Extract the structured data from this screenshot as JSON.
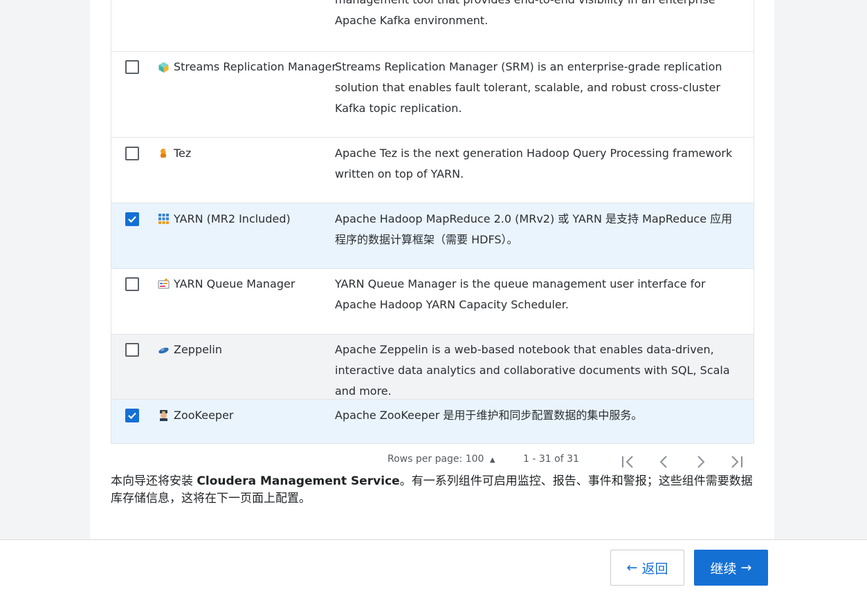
{
  "services": [
    {
      "name": "",
      "icon": "",
      "description": "management tool that provides end-to-end visibility in an enterprise Apache Kafka environment.",
      "checked": false
    },
    {
      "name": "Streams Replication Manager",
      "icon": "streams-replication-manager-icon",
      "description": "Streams Replication Manager (SRM) is an enterprise-grade replication solution that enables fault tolerant, scalable, and robust cross-cluster Kafka topic replication.",
      "checked": false
    },
    {
      "name": "Tez",
      "icon": "tez-icon",
      "description": "Apache Tez is the next generation Hadoop Query Processing framework written on top of YARN.",
      "checked": false
    },
    {
      "name": "YARN (MR2 Included)",
      "icon": "yarn-icon",
      "description": "Apache Hadoop MapReduce 2.0 (MRv2) 或 YARN 是支持 MapReduce 应用程序的数据计算框架（需要 HDFS）。",
      "checked": true
    },
    {
      "name": "YARN Queue Manager",
      "icon": "yarn-queue-manager-icon",
      "description": "YARN Queue Manager is the queue management user interface for Apache Hadoop YARN Capacity Scheduler.",
      "checked": false
    },
    {
      "name": "Zeppelin",
      "icon": "zeppelin-icon",
      "description": "Apache Zeppelin is a web-based notebook that enables data-driven, interactive data analytics and collaborative documents with SQL, Scala and more.",
      "checked": false
    },
    {
      "name": "ZooKeeper",
      "icon": "zookeeper-icon",
      "description": "Apache ZooKeeper 是用于维护和同步配置数据的集中服务。",
      "checked": true
    }
  ],
  "pagination": {
    "rows_per_page_label": "Rows per page: 100",
    "range": "1 - 31 of 31"
  },
  "note": {
    "prefix": "本向导还将安装 ",
    "service_name": "Cloudera Management Service",
    "suffix": "。有一系列组件可启用监控、报告、事件和警报；这些组件需要数据库存储信息，这将在下一页面上配置。"
  },
  "footer": {
    "back_label": "返回",
    "next_label": "继续"
  },
  "colors": {
    "accent": "#1570d4",
    "selected_row": "#eaf4fd"
  }
}
